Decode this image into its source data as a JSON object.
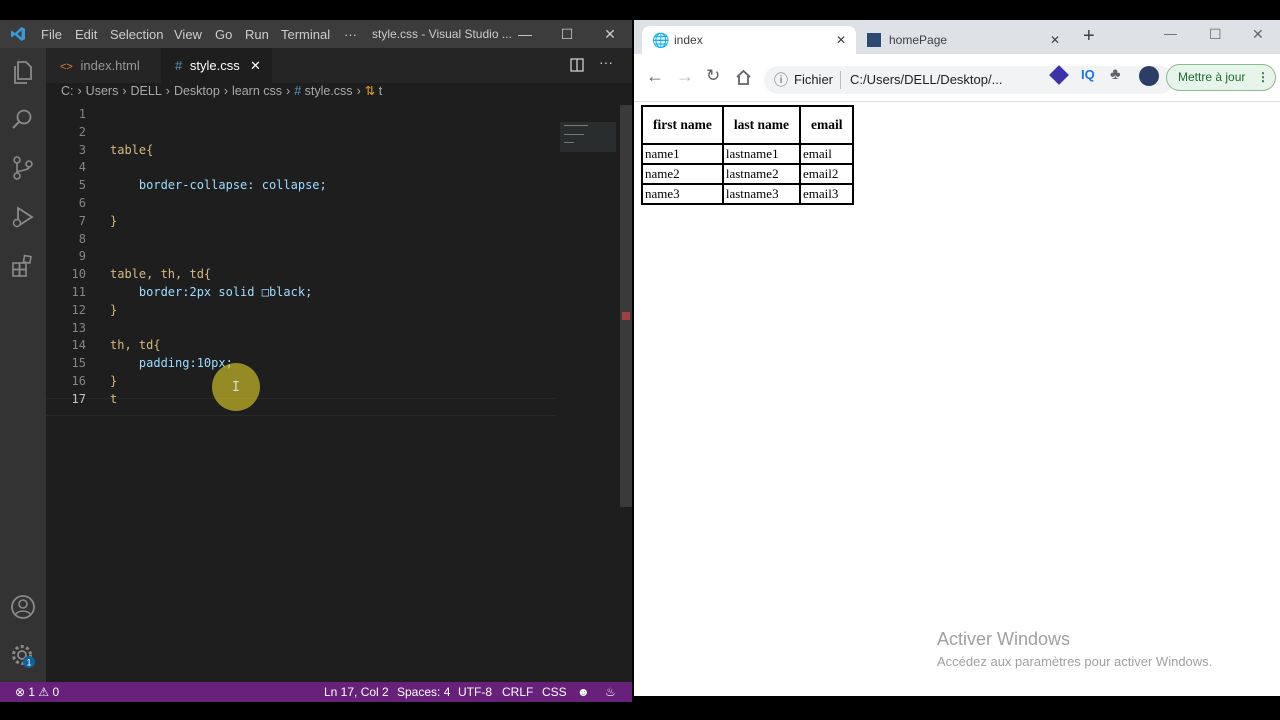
{
  "vscode": {
    "menu": [
      "File",
      "Edit",
      "Selection",
      "View",
      "Go",
      "Run",
      "Terminal",
      "···"
    ],
    "window_title": "style.css - Visual Studio ...",
    "tabs": [
      {
        "label": "index.html",
        "icon": "html-file-icon",
        "icon_glyph": "<>"
      },
      {
        "label": "style.css",
        "icon": "css-file-icon",
        "icon_glyph": "#"
      }
    ],
    "breadcrumb": [
      "C:",
      "Users",
      "DELL",
      "Desktop",
      "learn css",
      "style.css",
      "t"
    ],
    "code_lines": [
      {
        "n": "1",
        "text": ""
      },
      {
        "n": "2",
        "text": ""
      },
      {
        "n": "3",
        "text": "table{"
      },
      {
        "n": "4",
        "text": ""
      },
      {
        "n": "5",
        "text": "    border-collapse: collapse;"
      },
      {
        "n": "6",
        "text": ""
      },
      {
        "n": "7",
        "text": "}"
      },
      {
        "n": "8",
        "text": ""
      },
      {
        "n": "9",
        "text": ""
      },
      {
        "n": "10",
        "text": "table, th, td{"
      },
      {
        "n": "11",
        "text": "    border:2px solid □black;"
      },
      {
        "n": "12",
        "text": "}"
      },
      {
        "n": "13",
        "text": ""
      },
      {
        "n": "14",
        "text": "th, td{"
      },
      {
        "n": "15",
        "text": "    padding:10px;"
      },
      {
        "n": "16",
        "text": "}"
      },
      {
        "n": "17",
        "text": "t"
      }
    ],
    "status": {
      "problems": "⊗ 1 ⚠ 0",
      "position": "Ln 17, Col 2",
      "spaces": "Spaces: 4",
      "encoding": "UTF-8",
      "eol": "CRLF",
      "language": "CSS"
    },
    "status_color": "#68217a"
  },
  "chrome": {
    "tabs": [
      {
        "label": "index",
        "icon": "globe-icon"
      },
      {
        "label": "homePage",
        "icon": "page-favicon-icon"
      }
    ],
    "omnibox": {
      "scheme": "Fichier",
      "url": "C:/Users/DELL/Desktop/..."
    },
    "update_button": "Mettre à jour",
    "table": {
      "headers": [
        "first name",
        "last name",
        "email"
      ],
      "rows": [
        [
          "name1",
          "lastname1",
          "email"
        ],
        [
          "name2",
          "lastname2",
          "email2"
        ],
        [
          "name3",
          "lastname3",
          "email3"
        ]
      ]
    },
    "watermark": {
      "title": "Activer Windows",
      "subtitle": "Accédez aux paramètres pour activer Windows."
    }
  }
}
